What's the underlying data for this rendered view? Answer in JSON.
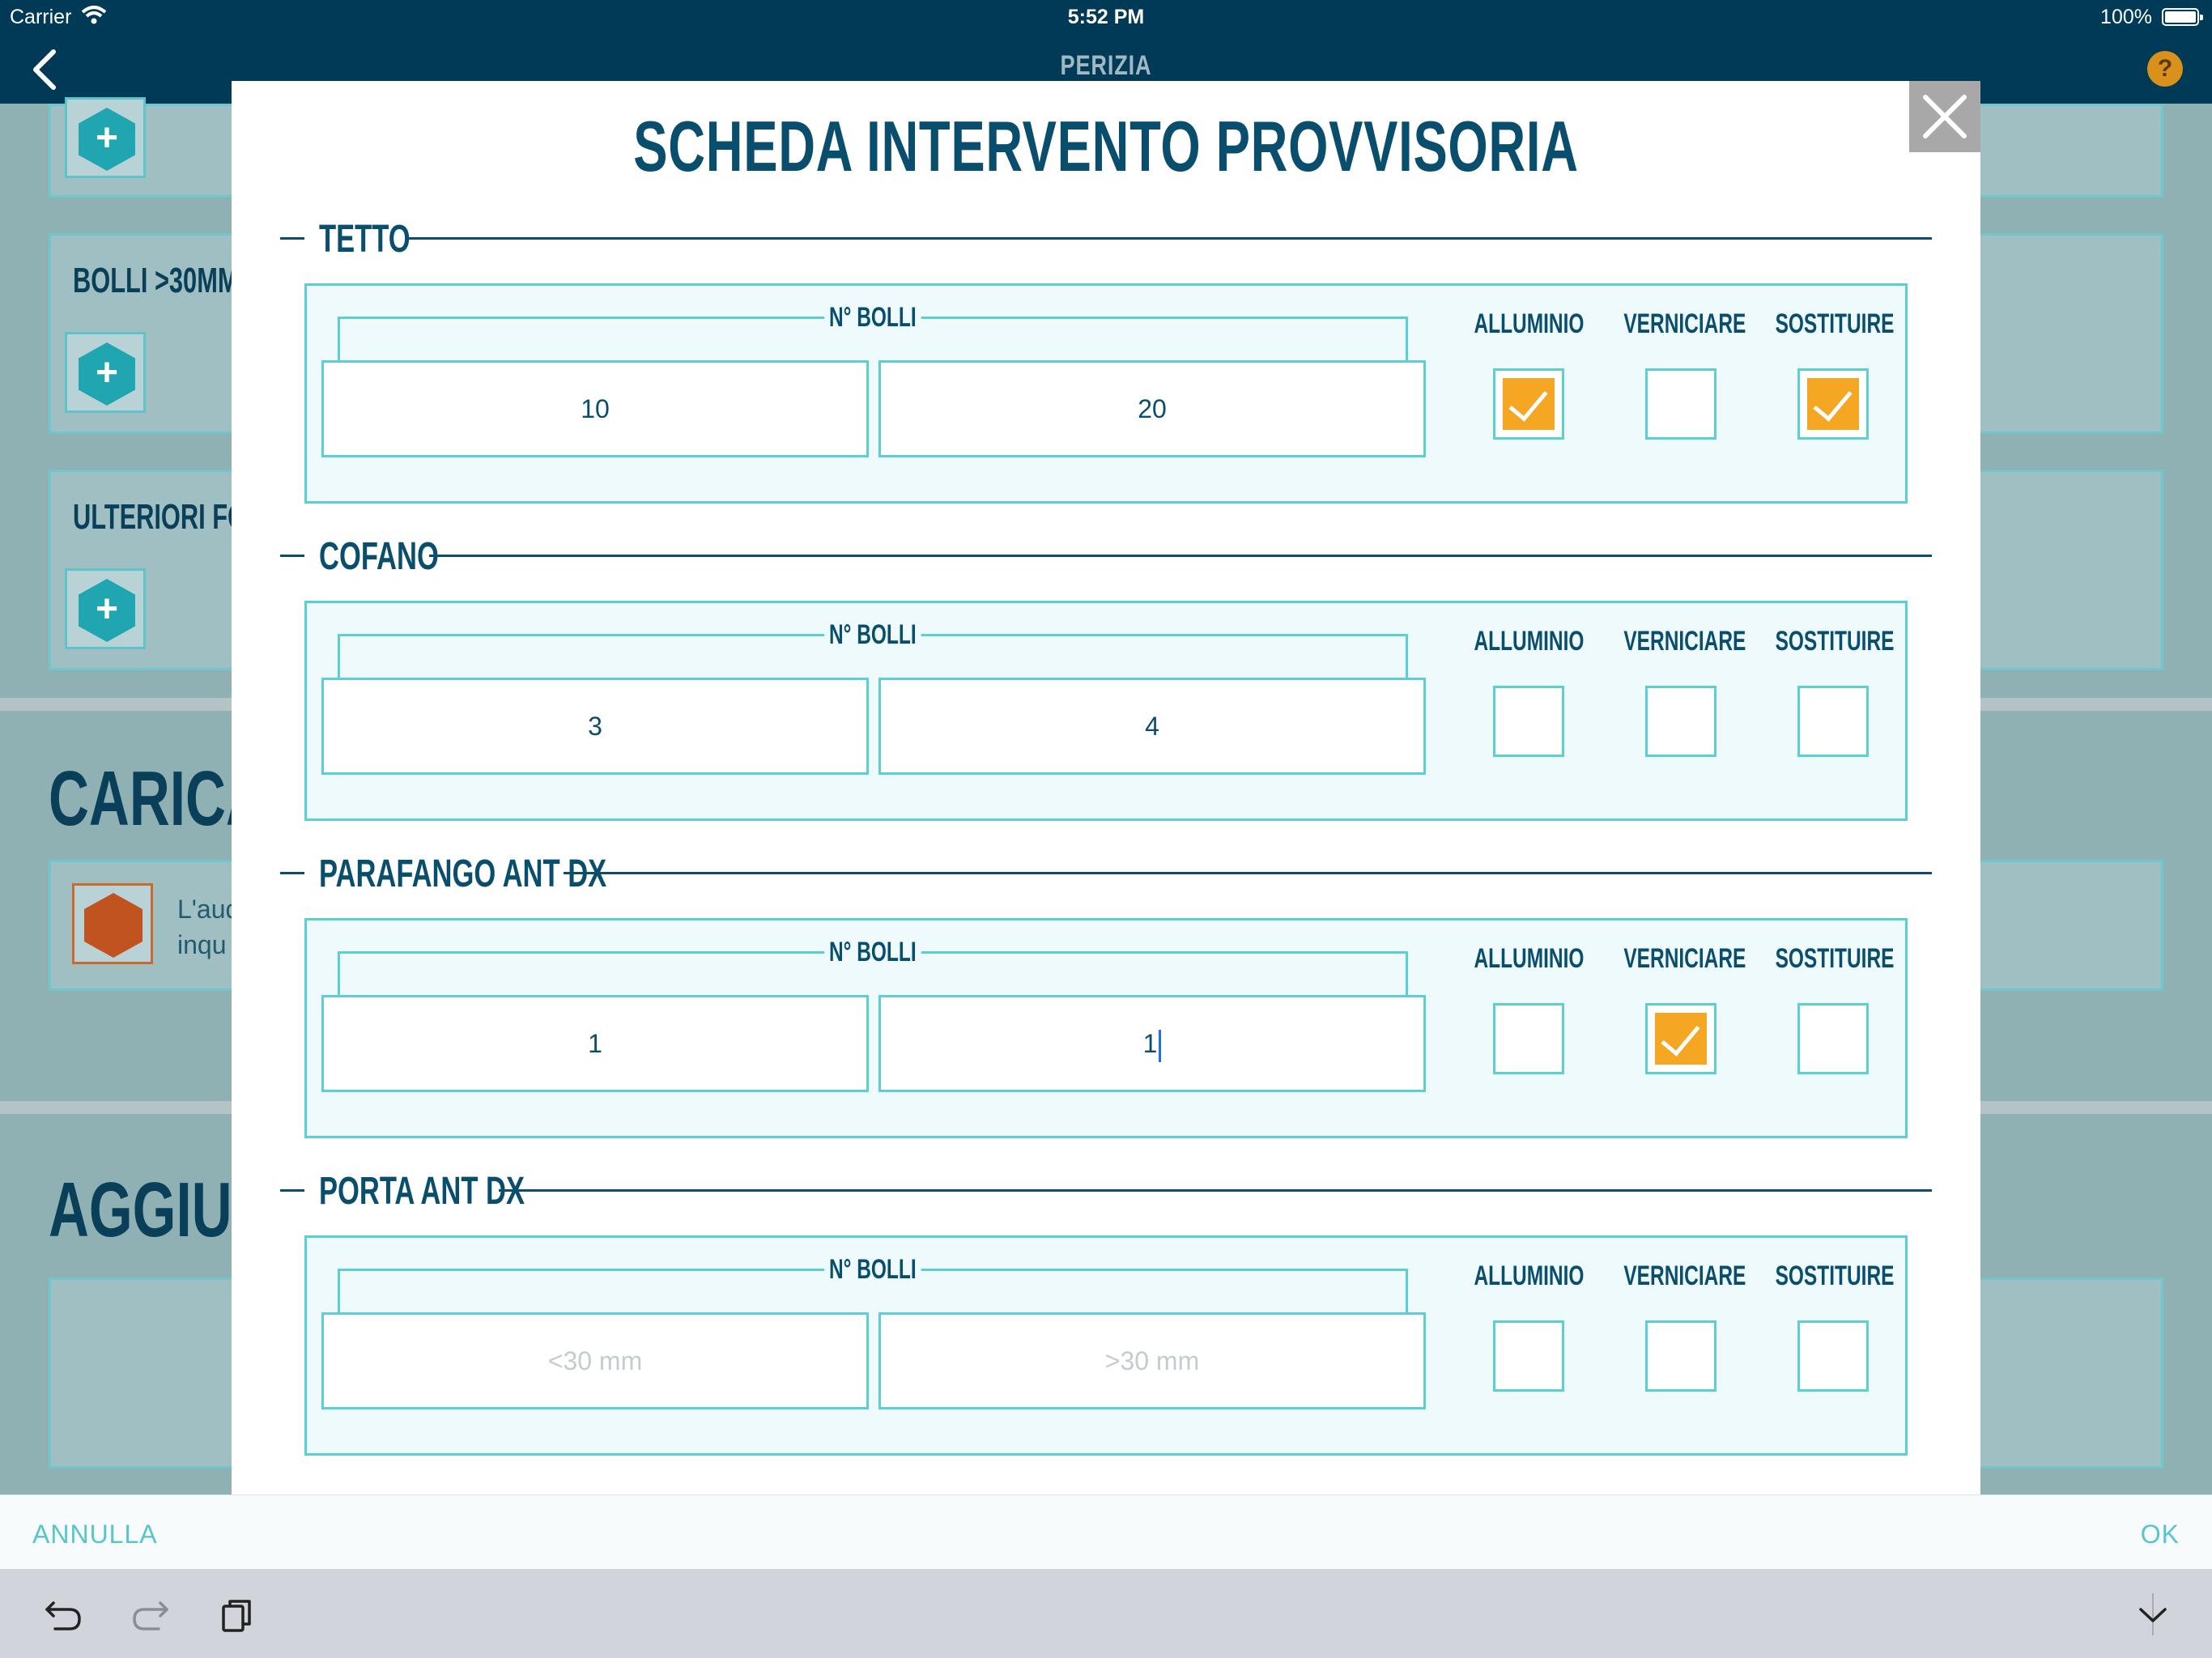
{
  "status_bar": {
    "carrier": "Carrier",
    "time": "5:52 PM",
    "battery": "100%"
  },
  "nav": {
    "title": "PERIZIA",
    "help_icon": "?"
  },
  "background": {
    "card_bolli": "BOLLI >30MM",
    "card_foto": "ULTERIORI FOT",
    "section_video": "CARICA V",
    "video_text_line1": "L'aud",
    "video_text_line2": "inqu",
    "section_add": "AGGIUN"
  },
  "modal": {
    "title": "SCHEDA INTERVENTO PROVVISORIA",
    "sections": [
      {
        "name": "TETTO",
        "bolli_label": "N° BOLLI",
        "small": "10",
        "large": "20",
        "small_placeholder": "<30 mm",
        "large_placeholder": ">30 mm",
        "opt_alluminio": "ALLUMINIO",
        "opt_verniciare": "VERNICIARE",
        "opt_sostituire": "SOSTITUIRE",
        "alluminio": true,
        "verniciare": false,
        "sostituire": true
      },
      {
        "name": "COFANO",
        "bolli_label": "N° BOLLI",
        "small": "3",
        "large": "4",
        "small_placeholder": "<30 mm",
        "large_placeholder": ">30 mm",
        "opt_alluminio": "ALLUMINIO",
        "opt_verniciare": "VERNICIARE",
        "opt_sostituire": "SOSTITUIRE",
        "alluminio": false,
        "verniciare": false,
        "sostituire": false
      },
      {
        "name": "PARAFANGO ANT DX",
        "bolli_label": "N° BOLLI",
        "small": "1",
        "large": "1",
        "small_placeholder": "<30 mm",
        "large_placeholder": ">30 mm",
        "opt_alluminio": "ALLUMINIO",
        "opt_verniciare": "VERNICIARE",
        "opt_sostituire": "SOSTITUIRE",
        "alluminio": false,
        "verniciare": true,
        "sostituire": false
      },
      {
        "name": "PORTA ANT DX",
        "bolli_label": "N° BOLLI",
        "small": "",
        "large": "",
        "small_placeholder": "<30 mm",
        "large_placeholder": ">30 mm",
        "opt_alluminio": "ALLUMINIO",
        "opt_verniciare": "VERNICIARE",
        "opt_sostituire": "SOSTITUIRE",
        "alluminio": false,
        "verniciare": false,
        "sostituire": false
      }
    ]
  },
  "actions": {
    "cancel": "ANNULLA",
    "ok": "OK"
  },
  "colors": {
    "primary": "#0a4e6e",
    "accent": "#5ccfd4",
    "check": "#f5a623",
    "nav_bg": "#003a57"
  }
}
